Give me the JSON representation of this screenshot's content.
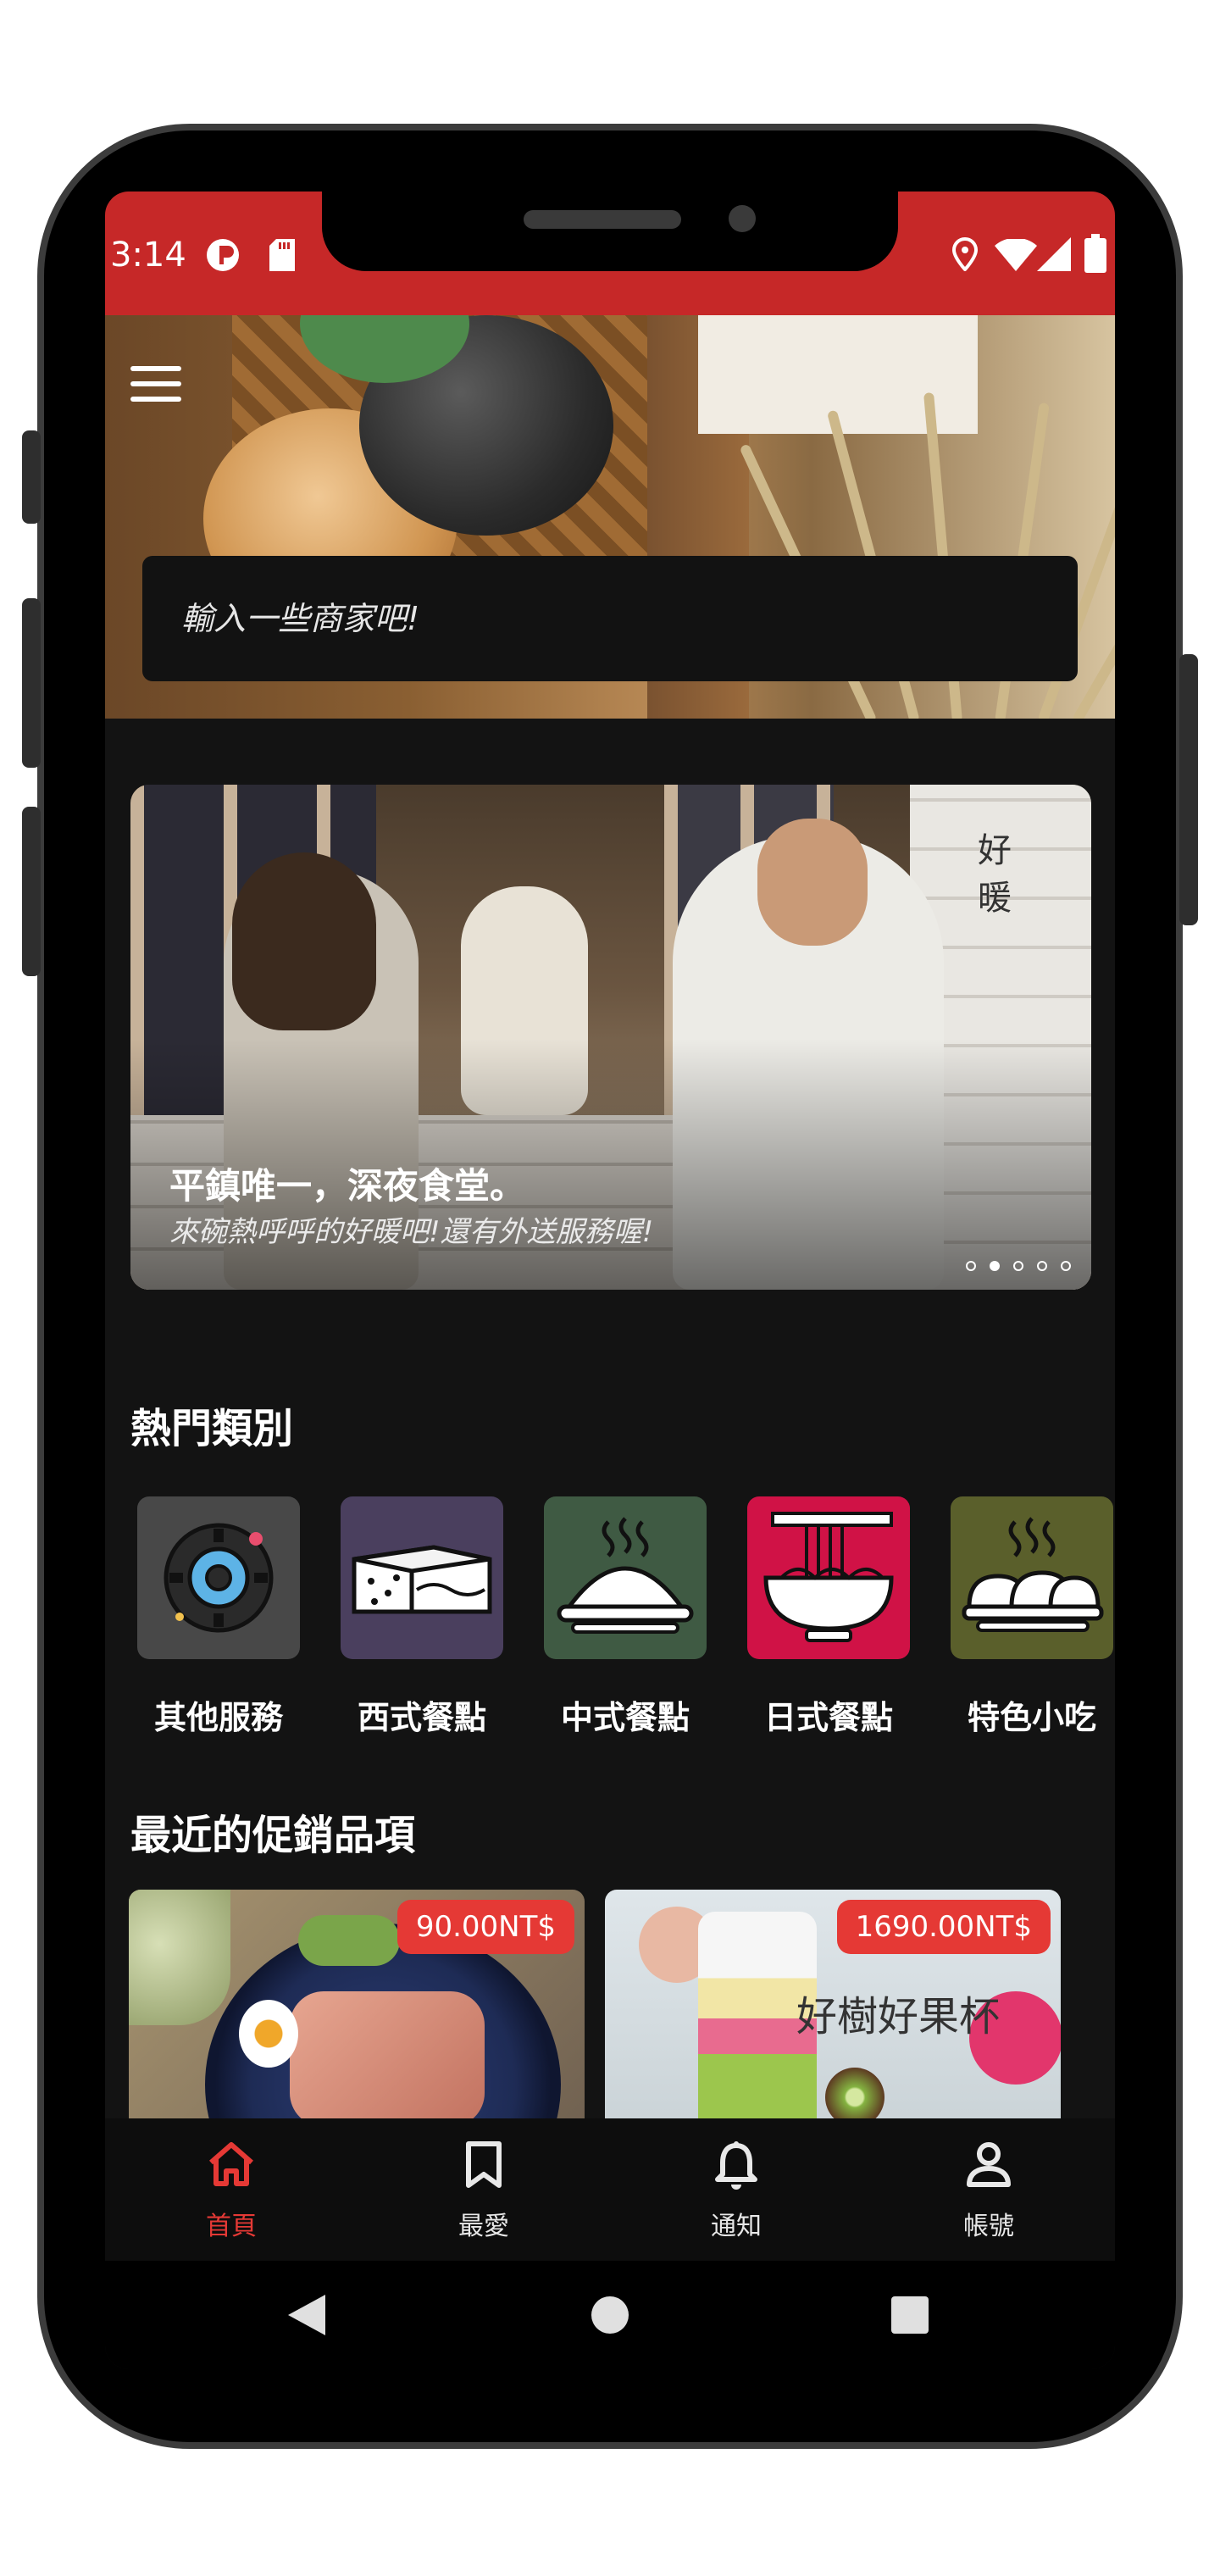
{
  "status_bar": {
    "time": "3:14",
    "background_color": "#c62828",
    "left_icons": [
      "app-logo-icon",
      "sd-card-icon"
    ],
    "right_icons": [
      "location-icon",
      "wifi-icon",
      "signal-icon",
      "battery-icon"
    ]
  },
  "header": {
    "menu_icon": "hamburger-menu-icon",
    "search_placeholder": "輸入一些商家吧!"
  },
  "banner": {
    "title": "平鎮唯一，深夜食堂。",
    "subtitle": "來碗熱呼呼的好暖吧!還有外送服務喔!",
    "shop_sign": "好暖",
    "dot_count": 5,
    "active_dot": 1
  },
  "categories_section": {
    "title": "熱門類別",
    "items": [
      {
        "label": "其他服務",
        "icon": "gear-icon",
        "color": "#484848"
      },
      {
        "label": "西式餐點",
        "icon": "cheese-icon",
        "color": "#4a3f5e"
      },
      {
        "label": "中式餐點",
        "icon": "rice-bowl-icon",
        "color": "#3f5a43"
      },
      {
        "label": "日式餐點",
        "icon": "ramen-bowl-icon",
        "color": "#d01246"
      },
      {
        "label": "特色小吃",
        "icon": "dumplings-icon",
        "color": "#5a5f2b"
      }
    ]
  },
  "promotions_section": {
    "title": "最近的促銷品項",
    "items": [
      {
        "price": "90.00NT$",
        "image": "rice-bowl-photo"
      },
      {
        "price": "1690.00NT$",
        "image": "juicer-cup-photo",
        "caption": "好樹好果杯"
      }
    ]
  },
  "bottom_nav": {
    "active_color": "#e53935",
    "items": [
      {
        "label": "首頁",
        "icon": "home-icon",
        "active": true
      },
      {
        "label": "最愛",
        "icon": "bookmark-icon",
        "active": false
      },
      {
        "label": "通知",
        "icon": "bell-icon",
        "active": false
      },
      {
        "label": "帳號",
        "icon": "account-icon",
        "active": false
      }
    ]
  },
  "system_nav": {
    "buttons": [
      "back-icon",
      "home-circle-icon",
      "recents-icon"
    ]
  }
}
